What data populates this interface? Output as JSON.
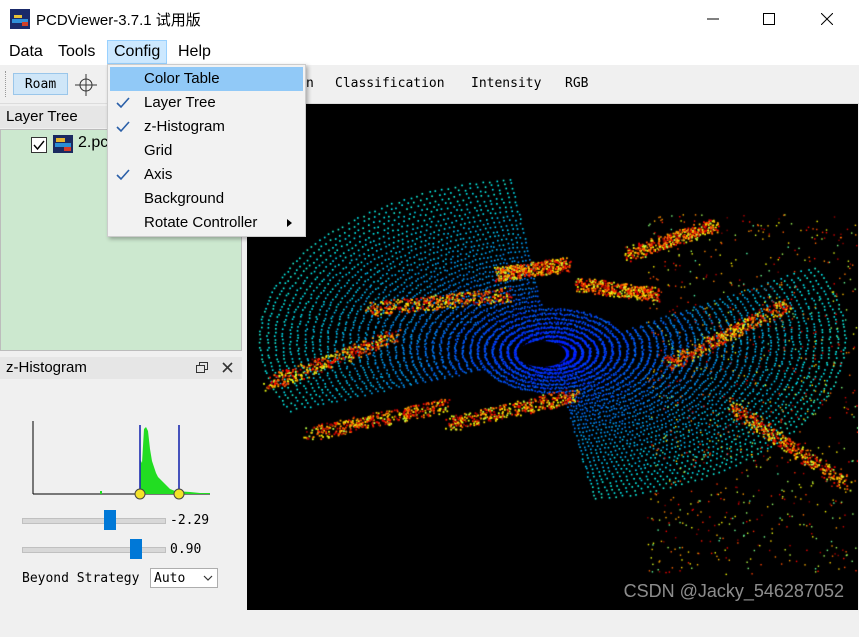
{
  "window": {
    "title": "PCDViewer-3.7.1 试用版"
  },
  "menubar": {
    "items": [
      "Data",
      "Tools",
      "Config",
      "Help"
    ]
  },
  "toolbar": {
    "roam": "Roam",
    "tabs": [
      "n",
      "Classification",
      "Intensity",
      "RGB"
    ]
  },
  "layer_tree": {
    "title": "Layer Tree",
    "file": "2.pc"
  },
  "z_histogram": {
    "title": "z-Histogram",
    "min_value": "-2.29",
    "max_value": "0.90",
    "min_slider_fraction": 0.62,
    "max_slider_fraction": 0.82,
    "beyond_label": "Beyond Strategy",
    "beyond_value": "Auto"
  },
  "config_menu": {
    "items": [
      {
        "label": "Color Table",
        "checked": false,
        "highlighted": true
      },
      {
        "label": "Layer Tree",
        "checked": true
      },
      {
        "label": "z-Histogram",
        "checked": true
      },
      {
        "label": "Grid",
        "checked": false
      },
      {
        "label": "Axis",
        "checked": true
      },
      {
        "label": "Background",
        "checked": false
      },
      {
        "label": "Rotate Controller",
        "checked": false,
        "submenu": true
      }
    ]
  },
  "watermark": "CSDN @Jacky_546287052",
  "colors": {
    "selection": "#91c9f7",
    "menu_active": "#cce8ff",
    "layer_bg": "#cce8cf"
  }
}
